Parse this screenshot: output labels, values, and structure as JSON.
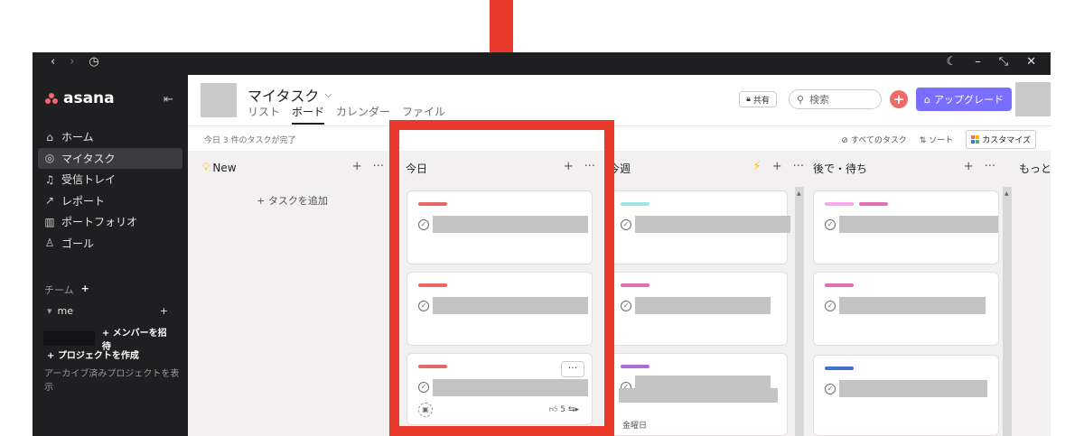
{
  "titlebar": {
    "back": "‹",
    "forward": "›",
    "history": "◷",
    "right_icons": [
      "☾",
      "–",
      "⤡",
      "✕"
    ]
  },
  "sidebar": {
    "logo": "asana",
    "items": [
      {
        "icon": "⌂",
        "label": "ホーム"
      },
      {
        "icon": "◎",
        "label": "マイタスク"
      },
      {
        "icon": "♫",
        "label": "受信トレイ"
      },
      {
        "icon": "↗",
        "label": "レポート"
      },
      {
        "icon": "▥",
        "label": "ポートフォリオ"
      },
      {
        "icon": "♙",
        "label": "ゴール"
      }
    ],
    "team_label": "チーム",
    "team_add": "+",
    "me_label": "me",
    "me_add": "+",
    "invite_label": "+ メンバーを招待",
    "create_project": "+ プロジェクトを作成",
    "archive": "アーカイブ済みプロジェクトを表示"
  },
  "header": {
    "title": "マイタスク",
    "tabs": [
      "リスト",
      "ボード",
      "カレンダー",
      "ファイル"
    ],
    "active_tab": "ボード",
    "share": "共有",
    "search_placeholder": "検索",
    "upgrade": "アップグレード"
  },
  "subbar": {
    "done_text": "今日 3 件のタスクが完了",
    "all_tasks": "すべてのタスク",
    "sort": "ソート",
    "customize": "カスタマイズ"
  },
  "columns": [
    {
      "title": "New",
      "add_task": "+ タスクを追加"
    },
    {
      "title": "今日"
    },
    {
      "title": "今週"
    },
    {
      "title": "後で・待ち"
    },
    {
      "title": "もっと先"
    }
  ],
  "cards": {
    "more": "···",
    "likes": "5",
    "due_label": "金曜日"
  },
  "colors": {
    "accent_red": "#e8392b",
    "upgrade_purple": "#796eff",
    "brand_coral": "#f06a6a",
    "tag_red": "#e66868",
    "tag_cyan": "#9ee7e3",
    "tag_pink": "#e270b2",
    "tag_light_pink": "#f9aaef",
    "tag_purple": "#b36bd4",
    "tag_blue": "#4573d2"
  }
}
